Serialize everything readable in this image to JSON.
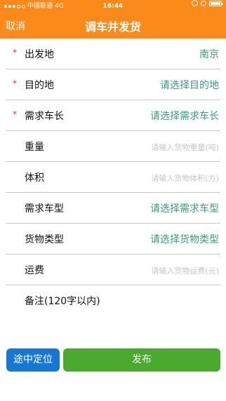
{
  "status_bar": {
    "carrier": "中国联通",
    "network": "4G",
    "time": "16:44",
    "battery_level": 1.0
  },
  "nav": {
    "cancel_label": "取消",
    "title": "调车并发货"
  },
  "form": {
    "required_mark": "*",
    "rows": [
      {
        "label": "出发地",
        "value": "南京",
        "kind": "value",
        "required": true
      },
      {
        "label": "目的地",
        "value": "请选择目的地",
        "kind": "value",
        "required": true
      },
      {
        "label": "需求车长",
        "value": "请选择需求车长",
        "kind": "value",
        "required": true
      },
      {
        "label": "重量",
        "value": "请输入货物重量(吨)",
        "kind": "placeholder",
        "required": false
      },
      {
        "label": "体积",
        "value": "请输入货物体积(方)",
        "kind": "placeholder",
        "required": false
      },
      {
        "label": "需求车型",
        "value": "请选择需求车型",
        "kind": "value",
        "required": false
      },
      {
        "label": "货物类型",
        "value": "请选择货物类型",
        "kind": "value",
        "required": false
      },
      {
        "label": "运费",
        "value": "请输入货物运费(元)",
        "kind": "placeholder",
        "required": false
      },
      {
        "label": "备注(120字以内)",
        "value": "",
        "kind": "none",
        "required": false
      }
    ]
  },
  "buttons": {
    "locate_label": "途中定位",
    "publish_label": "发布"
  },
  "colors": {
    "header": "#fb8a1a",
    "value_text": "#3a9d79",
    "required_mark": "#e0321c",
    "locate_button": "#1778d4",
    "publish_button": "#4aaa2e"
  }
}
